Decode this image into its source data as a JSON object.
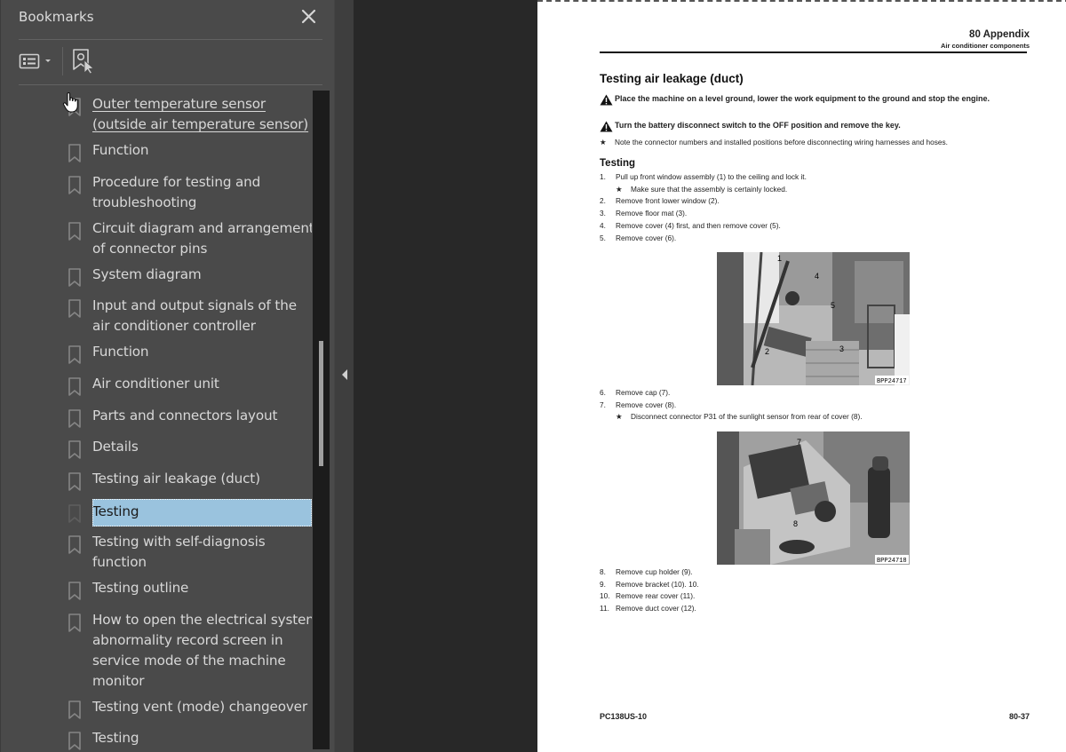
{
  "bookmarks_panel": {
    "title": "Bookmarks",
    "close_label": "Close",
    "options_label": "Options",
    "new_bookmark_label": "Add bookmark",
    "items": [
      {
        "label": "Outer temperature sensor \n(outside air temperature sensor)",
        "lines": [
          "Outer temperature sensor ",
          "(outside air temperature sensor)"
        ],
        "state": "hover"
      },
      {
        "label": "Function",
        "lines": [
          "Function"
        ]
      },
      {
        "label": "Procedure for testing and troubleshooting",
        "lines": [
          "Procedure for testing and",
          "troubleshooting"
        ]
      },
      {
        "label": "Circuit diagram and arrangement of connector pins",
        "lines": [
          "Circuit diagram and arrangement",
          "of connector pins"
        ]
      },
      {
        "label": "System diagram",
        "lines": [
          "System diagram"
        ]
      },
      {
        "label": "Input and output signals of the air conditioner controller",
        "lines": [
          "Input and output signals of the",
          "air conditioner controller"
        ]
      },
      {
        "label": "Function",
        "lines": [
          "Function"
        ]
      },
      {
        "label": "Air conditioner unit",
        "lines": [
          "Air conditioner unit"
        ]
      },
      {
        "label": "Parts and connectors layout",
        "lines": [
          "Parts and connectors layout"
        ]
      },
      {
        "label": "Details",
        "lines": [
          "Details"
        ]
      },
      {
        "label": "Testing air leakage (duct)",
        "lines": [
          "Testing air leakage (duct)"
        ]
      },
      {
        "label": "Testing",
        "lines": [
          "Testing"
        ],
        "state": "selected"
      },
      {
        "label": "Testing with self-diagnosis function",
        "lines": [
          "Testing with self-diagnosis",
          "function"
        ]
      },
      {
        "label": "Testing outline",
        "lines": [
          "Testing outline"
        ]
      },
      {
        "label": "How to open the electrical system abnormality record screen in service mode of the machine monitor",
        "lines": [
          "How to open the electrical system",
          "abnormality record screen in",
          "service mode of the machine",
          "monitor"
        ]
      },
      {
        "label": "Testing vent (mode) changeover",
        "lines": [
          "Testing vent (mode) changeover"
        ]
      },
      {
        "label": "Testing",
        "lines": [
          "Testing"
        ]
      }
    ],
    "scrollbar": {
      "position_fraction": 0.38,
      "visible_fraction": 0.19
    }
  },
  "collapse_label": "Collapse panel",
  "colors": {
    "panel_bg": "#4a4a4a",
    "selection": "#9ac3de",
    "doc_bg": "#282828",
    "page_bg": "#ffffff"
  },
  "page": {
    "header_section": "80 Appendix",
    "header_subsection": "Air conditioner components",
    "title": "Testing air leakage (duct)",
    "warnings": [
      "Place the machine on a level ground, lower the work equipment to the ground and stop the engine.",
      "Turn the battery disconnect switch to the OFF position and remove the key."
    ],
    "note": "Note the connector numbers and installed positions before disconnecting wiring harnesses and hoses.",
    "subtitle": "Testing",
    "steps_a": [
      {
        "num": "1.",
        "text": "Pull up front window assembly (1) to the ceiling and lock it."
      },
      {
        "num": "",
        "star": true,
        "text": "Make sure that the assembly is certainly locked."
      },
      {
        "num": "2.",
        "text": "Remove front lower window (2)."
      },
      {
        "num": "3.",
        "text": "Remove floor mat (3)."
      },
      {
        "num": "4.",
        "text": "Remove cover (4) first, and then remove cover (5)."
      },
      {
        "num": "5.",
        "text": "Remove cover (6)."
      }
    ],
    "figure1": {
      "id": "BPP24717",
      "callouts": [
        "1",
        "2",
        "3",
        "4",
        "5"
      ]
    },
    "steps_b": [
      {
        "num": "6.",
        "text": "Remove cap (7)."
      },
      {
        "num": "7.",
        "text": "Remove cover (8)."
      },
      {
        "num": "",
        "star": true,
        "text": "Disconnect connector P31 of the sunlight sensor from rear of cover (8)."
      }
    ],
    "figure2": {
      "id": "BPP24718",
      "callouts": [
        "7",
        "8"
      ]
    },
    "steps_c": [
      {
        "num": "8.",
        "text": "Remove cup holder (9)."
      },
      {
        "num": "9.",
        "text": "Remove bracket (10). 10."
      },
      {
        "num": "10.",
        "text": "Remove rear cover (11)."
      },
      {
        "num": "11.",
        "text": "Remove duct cover (12)."
      }
    ],
    "footer_model": "PC138US-10",
    "footer_page": "80-37"
  }
}
